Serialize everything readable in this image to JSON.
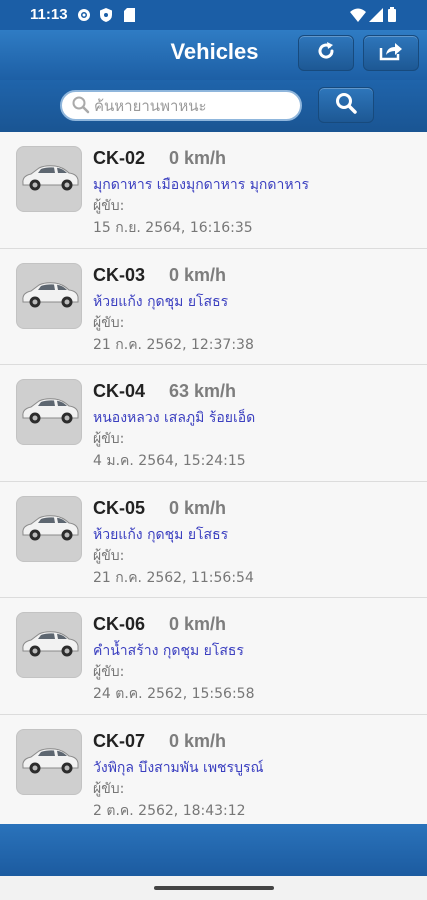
{
  "status_bar": {
    "time": "11:13"
  },
  "header": {
    "title": "Vehicles"
  },
  "search": {
    "placeholder": "ค้นหายานพาหนะ",
    "value": ""
  },
  "vehicles": [
    {
      "plate": "CK-02",
      "speed": "0 km/h",
      "location": "มุกดาหาร เมืองมุกดาหาร มุกดาหาร",
      "driver_label": "ผู้ขับ:",
      "timestamp": "15 ก.ย. 2564, 16:16:35"
    },
    {
      "plate": "CK-03",
      "speed": "0 km/h",
      "location": "ห้วยแก้ง กุดชุม ยโสธร",
      "driver_label": "ผู้ขับ:",
      "timestamp": "21 ก.ค. 2562, 12:37:38"
    },
    {
      "plate": "CK-04",
      "speed": "63 km/h",
      "location": "หนองหลวง เสลภูมิ ร้อยเอ็ด",
      "driver_label": "ผู้ขับ:",
      "timestamp": "4 ม.ค. 2564, 15:24:15"
    },
    {
      "plate": "CK-05",
      "speed": "0 km/h",
      "location": "ห้วยแก้ง กุดชุม ยโสธร",
      "driver_label": "ผู้ขับ:",
      "timestamp": "21 ก.ค. 2562, 11:56:54"
    },
    {
      "plate": "CK-06",
      "speed": "0 km/h",
      "location": "คำน้ำสร้าง กุดชุม ยโสธร",
      "driver_label": "ผู้ขับ:",
      "timestamp": "24 ต.ค. 2562, 15:56:58"
    },
    {
      "plate": "CK-07",
      "speed": "0 km/h",
      "location": "วังพิกุล บึงสามพัน เพชรบูรณ์",
      "driver_label": "ผู้ขับ:",
      "timestamp": "2 ต.ค. 2562, 18:43:12"
    }
  ],
  "icons": {
    "refresh": "refresh-icon",
    "share": "share-icon",
    "search": "search-icon",
    "vehicle": "car-icon"
  },
  "colors": {
    "header": "#1d5fa5",
    "location_text": "#3b3fc0",
    "speed_text": "#7d7d7d"
  }
}
